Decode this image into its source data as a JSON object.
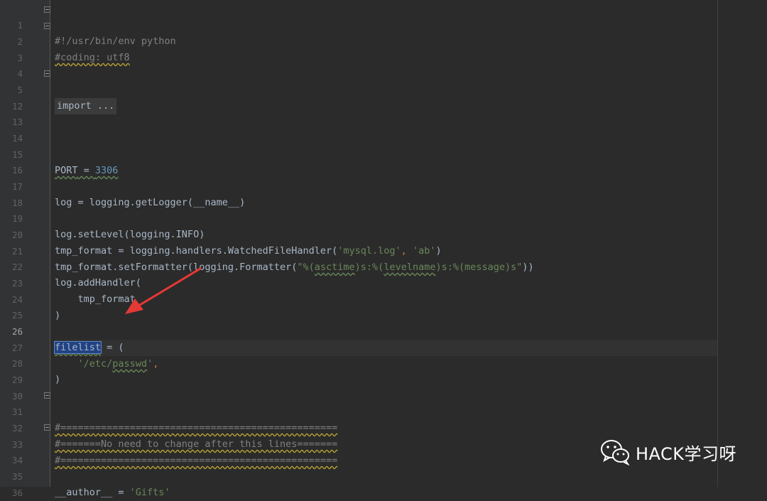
{
  "editor": {
    "current_line": "26",
    "lines": [
      {
        "n": "1"
      },
      {
        "n": "2"
      },
      {
        "n": "3"
      },
      {
        "n": "4"
      },
      {
        "n": "5"
      },
      {
        "n": "12"
      },
      {
        "n": "13"
      },
      {
        "n": "14"
      },
      {
        "n": "15"
      },
      {
        "n": "16"
      },
      {
        "n": "17"
      },
      {
        "n": "18"
      },
      {
        "n": "19"
      },
      {
        "n": "20"
      },
      {
        "n": "21"
      },
      {
        "n": "22"
      },
      {
        "n": "23"
      },
      {
        "n": "24"
      },
      {
        "n": "25"
      },
      {
        "n": "26"
      },
      {
        "n": "27"
      },
      {
        "n": "28"
      },
      {
        "n": "29"
      },
      {
        "n": "30"
      },
      {
        "n": "31"
      },
      {
        "n": "32"
      },
      {
        "n": "33"
      },
      {
        "n": "34"
      },
      {
        "n": "35"
      },
      {
        "n": "36"
      }
    ],
    "code": {
      "l1": "#!/usr/bin/env python",
      "l2": "#coding: utf8",
      "l5_fold": "import ...",
      "l15_a": "PORT",
      "l15_b": " = ",
      "l15_c": "3306",
      "l17": "log = logging.getLogger(__name__)",
      "l19": "log.setLevel(logging.INFO)",
      "l20_a": "tmp_format = logging.handlers.WatchedFileHandler(",
      "l20_b": "'mysql.log'",
      "l20_c": ", ",
      "l20_d": "'ab'",
      "l20_e": ")",
      "l21_a": "tmp_format.setFormatter(logging.Formatter(",
      "l21_b": "\"%(",
      "l21_c": "asctime",
      "l21_d": ")s:%(",
      "l21_e": "levelname",
      "l21_f": ")s:%(message)s\"",
      "l21_g": "))",
      "l22": "log.addHandler(",
      "l23": "    tmp_format",
      "l24": ")",
      "l26_a": "filelist",
      "l26_b": " = (",
      "l27_a": "    ",
      "l27_b": "'/etc/",
      "l27_c": "passwd",
      "l27_d": "'",
      "l27_e": ",",
      "l28": ")",
      "l31": "#================================================",
      "l32": "#=======No need to change after this lines=======",
      "l33": "#================================================",
      "l35_a": "__author__",
      "l35_b": " = ",
      "l35_c": "'Gifts'"
    }
  },
  "watermark": {
    "text": "HACK学习呀",
    "icon": "wechat-icon"
  },
  "colors": {
    "background": "#2b2b2b",
    "gutter": "#313335",
    "keyword": "#cc7832",
    "string": "#6a8759",
    "number": "#6897bb",
    "comment": "#808080",
    "arrow": "#e53935"
  }
}
